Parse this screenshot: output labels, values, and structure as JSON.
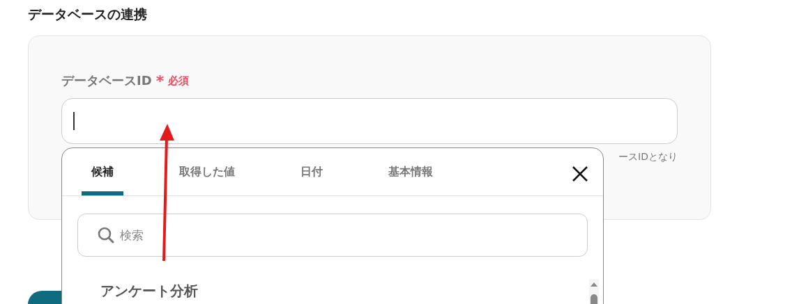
{
  "section": {
    "title": "データベースの連携"
  },
  "field": {
    "label": "データベースID",
    "required_mark": "*",
    "required_text": "必須",
    "hint": "ースIDとなり"
  },
  "popup": {
    "tabs": [
      {
        "label": "候補",
        "selected": true
      },
      {
        "label": "取得した値",
        "selected": false
      },
      {
        "label": "日付",
        "selected": false
      },
      {
        "label": "基本情報",
        "selected": false
      }
    ],
    "search": {
      "placeholder": "検索"
    },
    "items": [
      {
        "label": "アンケート分析"
      }
    ]
  }
}
